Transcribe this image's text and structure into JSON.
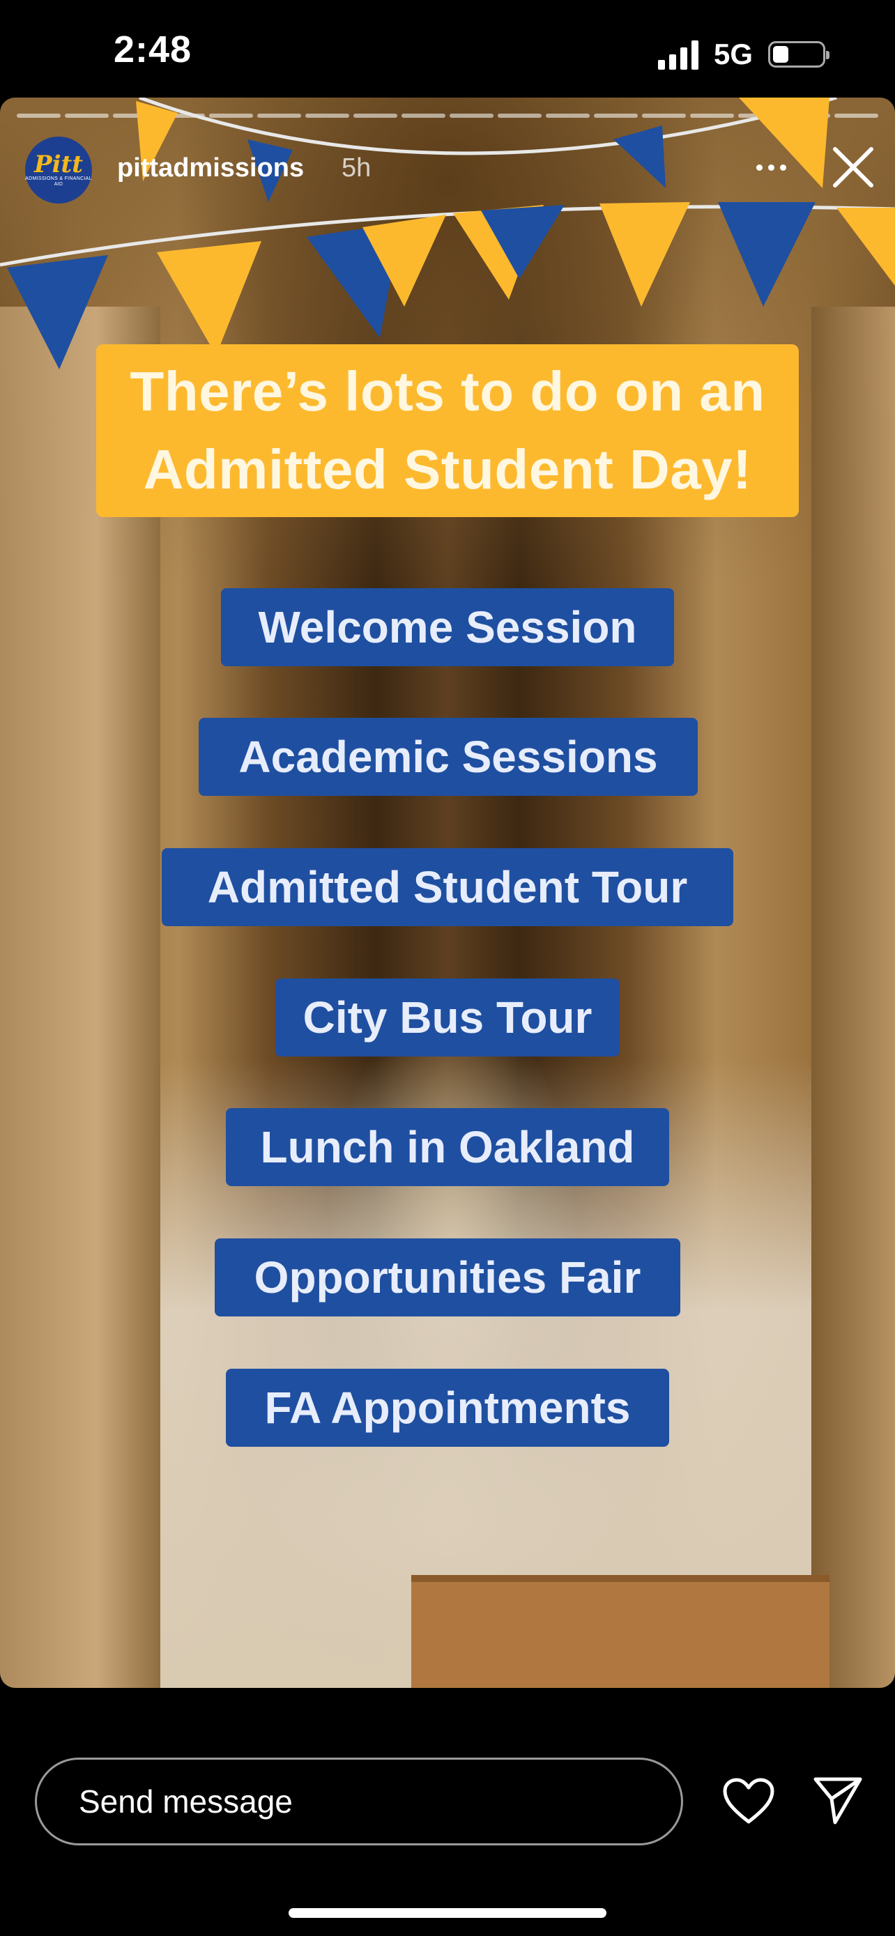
{
  "status_bar": {
    "time": "2:48",
    "network": "5G"
  },
  "story": {
    "progress_segments": 18,
    "account": {
      "username": "pittadmissions",
      "time_ago": "5h",
      "avatar_text": "Pitt",
      "avatar_subtext": "ADMISSIONS & FINANCIAL AID"
    },
    "title_line1": "There’s lots to do on an",
    "title_line2": "Admitted Student Day!",
    "items": [
      "Welcome Session",
      "Academic Sessions",
      "Admitted Student Tour",
      "City Bus Tour",
      "Lunch in Oakland",
      "Opportunities Fair",
      "FA Appointments"
    ]
  },
  "reply_bar": {
    "placeholder": "Send message"
  },
  "colors": {
    "pitt_blue": "#1f4fa0",
    "pitt_gold": "#fdb92e"
  }
}
